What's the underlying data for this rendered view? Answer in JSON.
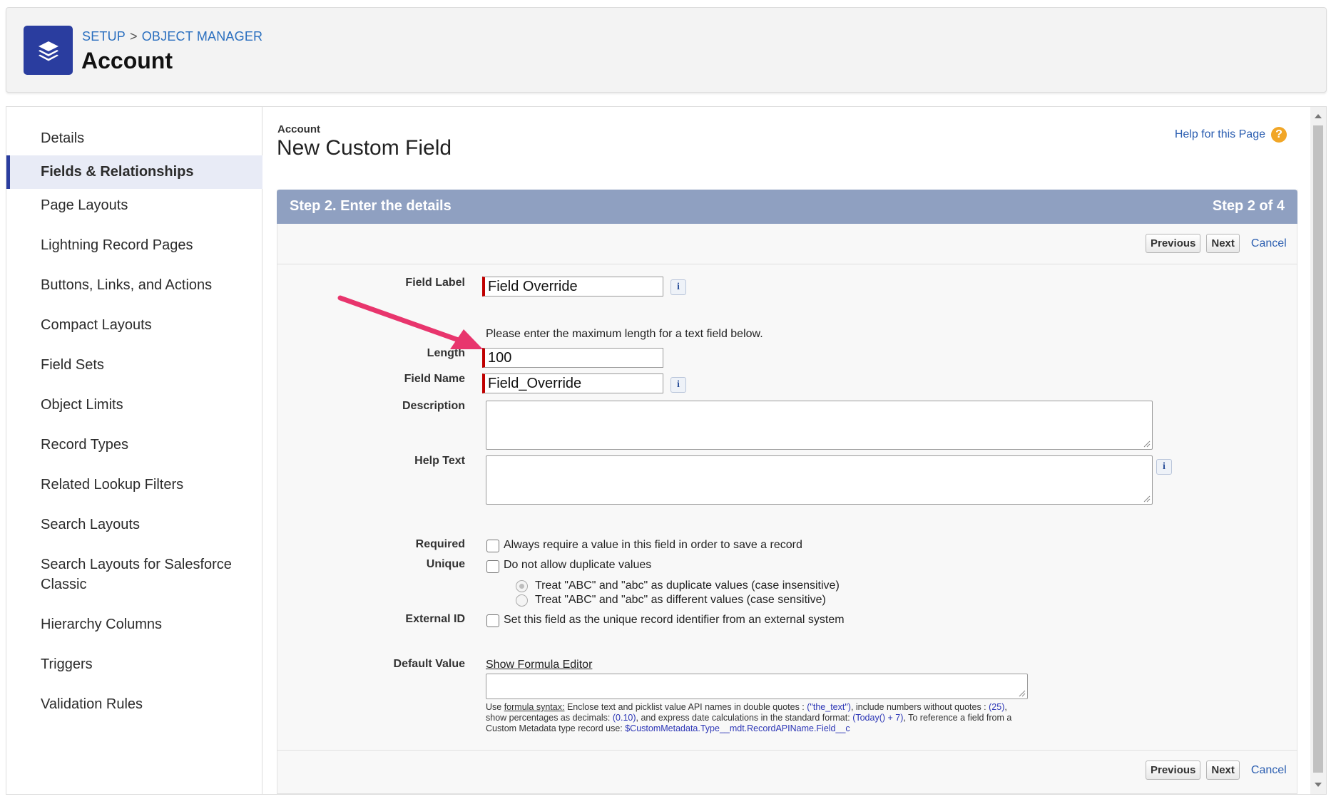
{
  "header": {
    "breadcrumb": [
      "SETUP",
      "OBJECT MANAGER"
    ],
    "breadcrumb_separator": ">",
    "title": "Account",
    "app_icon": "layers-icon"
  },
  "sidebar": {
    "items": [
      {
        "label": "Details"
      },
      {
        "label": "Fields & Relationships",
        "active": true
      },
      {
        "label": "Page Layouts"
      },
      {
        "label": "Lightning Record Pages"
      },
      {
        "label": "Buttons, Links, and Actions"
      },
      {
        "label": "Compact Layouts"
      },
      {
        "label": "Field Sets"
      },
      {
        "label": "Object Limits"
      },
      {
        "label": "Record Types"
      },
      {
        "label": "Related Lookup Filters"
      },
      {
        "label": "Search Layouts"
      },
      {
        "label": "Search Layouts for Salesforce Classic"
      },
      {
        "label": "Hierarchy Columns"
      },
      {
        "label": "Triggers"
      },
      {
        "label": "Validation Rules"
      }
    ]
  },
  "main": {
    "object_label": "Account",
    "title": "New Custom Field",
    "help_link": "Help for this Page",
    "step_title": "Step 2. Enter the details",
    "step_counter": "Step 2 of 4",
    "buttons": {
      "previous": "Previous",
      "next": "Next",
      "cancel": "Cancel"
    },
    "form": {
      "field_label": {
        "label": "Field Label",
        "value": "Field Override"
      },
      "length_note": "Please enter the maximum length for a text field below.",
      "length": {
        "label": "Length",
        "value": "100"
      },
      "field_name": {
        "label": "Field Name",
        "value": "Field_Override"
      },
      "description": {
        "label": "Description",
        "value": ""
      },
      "help_text": {
        "label": "Help Text",
        "value": ""
      },
      "required": {
        "label": "Required",
        "text": "Always require a value in this field in order to save a record",
        "checked": false
      },
      "unique": {
        "label": "Unique",
        "text": "Do not allow duplicate values",
        "checked": false,
        "options": [
          {
            "text": "Treat \"ABC\" and \"abc\" as duplicate values (case insensitive)",
            "selected": true,
            "disabled": true
          },
          {
            "text": "Treat \"ABC\" and \"abc\" as different values (case sensitive)",
            "selected": false,
            "disabled": true
          }
        ]
      },
      "external_id": {
        "label": "External ID",
        "text": "Set this field as the unique record identifier from an external system",
        "checked": false
      },
      "default_value": {
        "label": "Default Value",
        "formula_link": "Show Formula Editor",
        "value": "",
        "hint": {
          "p1": "Use ",
          "formula_syntax": "formula syntax:",
          "p2": " Enclose text and picklist value API names in double quotes : ",
          "ex1": "(\"the_text\")",
          "p3": ", include numbers without quotes : ",
          "ex2": "(25)",
          "p4": ", show percentages as decimals: ",
          "ex3": "(0.10)",
          "p5": ", and express date calculations in the standard format: ",
          "ex4": "(Today() + 7)",
          "p6": ", To reference a field from a Custom Metadata type record use: ",
          "ex5": "$CustomMetadata.Type__mdt.RecordAPIName.Field__c"
        }
      }
    }
  },
  "colors": {
    "brand": "#2a3d9f",
    "step_bar": "#8fa0c1",
    "required_marker": "#c00000",
    "annotation_arrow": "#e8356d",
    "link": "#2a5db0"
  }
}
